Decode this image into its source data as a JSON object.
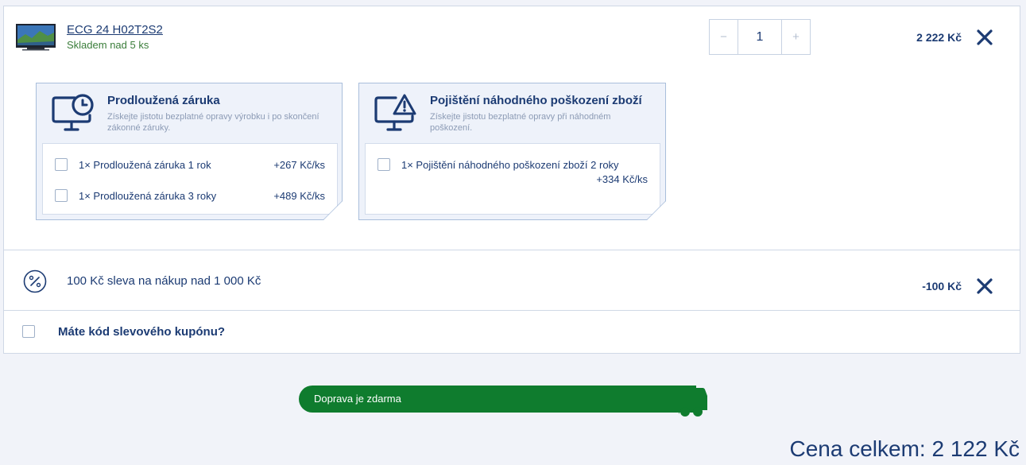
{
  "product": {
    "name": "ECG 24 H02T2S2",
    "stock": "Skladem nad 5 ks",
    "quantity": "1",
    "qty_minus": "−",
    "qty_plus": "+",
    "price": "2 222 Kč",
    "remove_icon": "close-icon"
  },
  "services": [
    {
      "title": "Prodloužená záruka",
      "description": "Získejte jistotu bezplatné opravy výrobku i po skončení zákonné záruky.",
      "icon": "monitor-clock-icon",
      "options": [
        {
          "label": "1× Prodloužená záruka 1 rok",
          "price": "+267 Kč/ks"
        },
        {
          "label": "1× Prodloužená záruka 3 roky",
          "price": "+489 Kč/ks"
        }
      ]
    },
    {
      "title": "Pojištění náhodného poškození zboží",
      "description": "Získejte jistotu bezplatné opravy při náhodném poškození.",
      "icon": "monitor-warning-icon",
      "options": [
        {
          "label": "1× Pojištění náhodného poškození zboží 2 roky",
          "price": "+334 Kč/ks"
        }
      ]
    }
  ],
  "discount": {
    "label": "100 Kč sleva na nákup nad 1 000 Kč",
    "amount": "-100 Kč",
    "icon": "percent-icon"
  },
  "coupon": {
    "label": "Máte kód slevového kupónu?"
  },
  "shipping": {
    "label": "Doprava je zdarma",
    "progress_percent": 100,
    "icon": "truck-icon"
  },
  "total": {
    "label": "Cena celkem: 2 122 Kč"
  },
  "colors": {
    "brand": "#1c3b73",
    "success": "#0f7c2e",
    "stock": "#3a7d3a",
    "page_bg": "#f1f3f9"
  }
}
